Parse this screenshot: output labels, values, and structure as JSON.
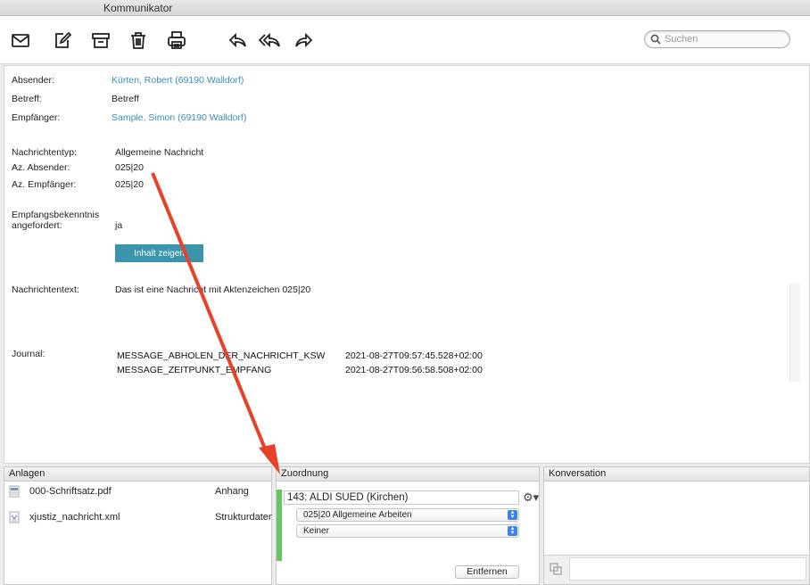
{
  "window": {
    "title": "Kommunikator"
  },
  "toolbar": {
    "buttons": [
      {
        "icon": "envelope-icon"
      },
      {
        "icon": "compose-icon"
      },
      {
        "icon": "archive-icon"
      },
      {
        "icon": "trash-icon"
      },
      {
        "icon": "print-icon"
      },
      {
        "icon": "reply-icon"
      },
      {
        "icon": "reply-all-icon"
      },
      {
        "icon": "forward-icon"
      }
    ],
    "search_placeholder": "Suchen"
  },
  "message": {
    "absender_label": "Absender:",
    "absender_value": "Kürten, Robert (69190 Walldorf)",
    "betreff_label": "Betreff:",
    "betreff_value": "Betreff",
    "empfaenger_label": "Empfänger:",
    "empfaenger_value": "Sample, Simon (69190 Walldorf)",
    "nachrichtentyp_label": "Nachrichtentyp:",
    "nachrichtentyp_value": "Allgemeine Nachricht",
    "az_absender_label": "Az. Absender:",
    "az_absender_value": "025|20",
    "az_empfaenger_label": "Az. Empfänger:",
    "az_empfaenger_value": "025|20",
    "bekenntnis_label_1": "Empfangsbekenntnis",
    "bekenntnis_label_2": "angefordert:",
    "bekenntnis_value": "ja",
    "inhalt_button": "Inhalt zeigen",
    "nachrichtentext_label": "Nachrichtentext:",
    "nachrichtentext_value": "Das ist eine Nachricht mit Aktenzeichen 025|20",
    "journal_label": "Journal:",
    "journal": [
      {
        "msg": "MESSAGE_ABHOLEN_DER_NACHRICHT_KSW",
        "ts": "2021-08-27T09:57:45.528+02:00"
      },
      {
        "msg": "MESSAGE_ZEITPUNKT_EMPFANG",
        "ts": "2021-08-27T09:56:58.508+02:00"
      }
    ]
  },
  "anlagen": {
    "title": "Anlagen",
    "items": [
      {
        "name": "000-Schriftsatz.pdf",
        "type": "Anhang",
        "icon": "pdf-file-icon"
      },
      {
        "name": "xjustiz_nachricht.xml",
        "type": "Strukturdaten",
        "icon": "xml-file-icon"
      }
    ]
  },
  "zuordnung": {
    "title": "Zuordnung",
    "akte": "143: ALDI SUED (Kirchen)",
    "select_1": "025|20 Allgemeine Arbeiten",
    "select_2": "Keiner",
    "remove_button": "Entfernen",
    "accent": "#6ac463"
  },
  "konversation": {
    "title": "Konversation"
  },
  "colors": {
    "link": "#3a8fb7",
    "button": "#3b94ad",
    "arrow": "#e8412a"
  }
}
